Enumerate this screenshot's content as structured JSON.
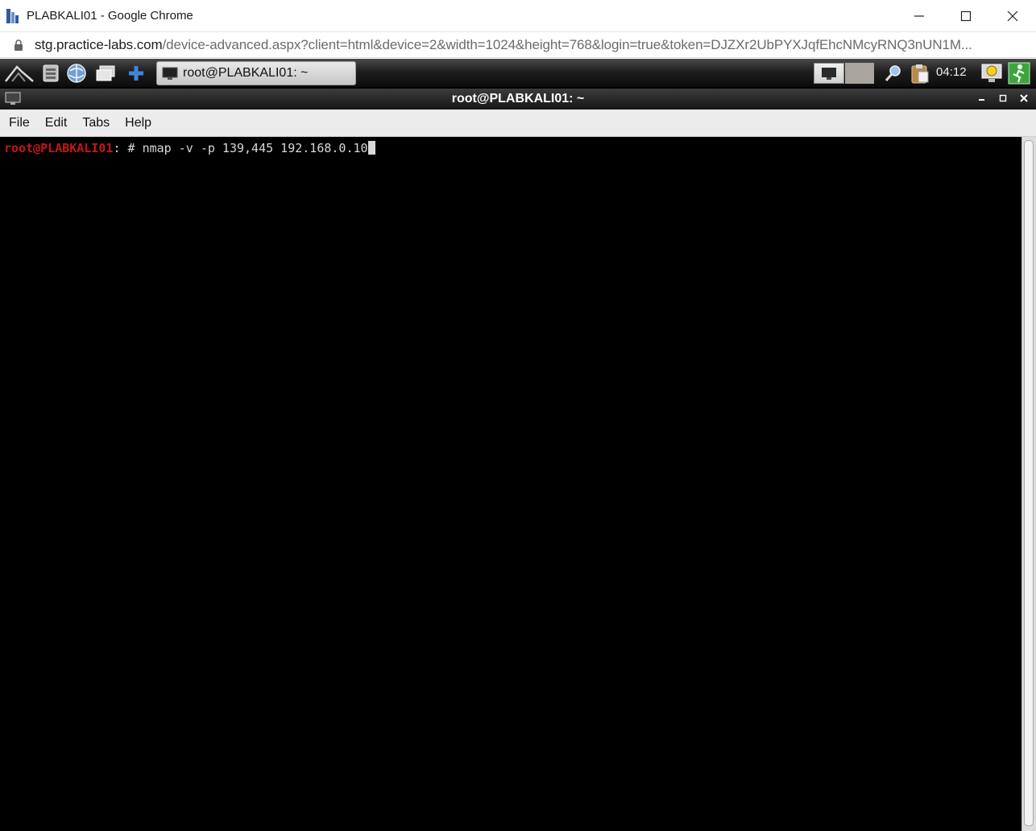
{
  "browser": {
    "window_title": "PLABKALI01 - Google Chrome",
    "url_host": "stg.practice-labs.com",
    "url_path": "/device-advanced.aspx?client=html&device=2&width=1024&height=768&login=true&token=DJZXr2UbPYXJqfEhcNMcyRNQ3nUN1M..."
  },
  "panel": {
    "taskbar_item": "root@PLABKALI01: ~",
    "clock": "04:12"
  },
  "terminal": {
    "title": "root@PLABKALI01: ~",
    "menu": [
      "File",
      "Edit",
      "Tabs",
      "Help"
    ],
    "prompt_user": "root@PLABKALI01",
    "prompt_suffix": ": # ",
    "command": "nmap -v -p 139,445 192.168.0.10"
  },
  "colors": {
    "prompt_red": "#c01818",
    "terminal_bg": "#000000",
    "terminal_fg": "#d8d8d8"
  }
}
